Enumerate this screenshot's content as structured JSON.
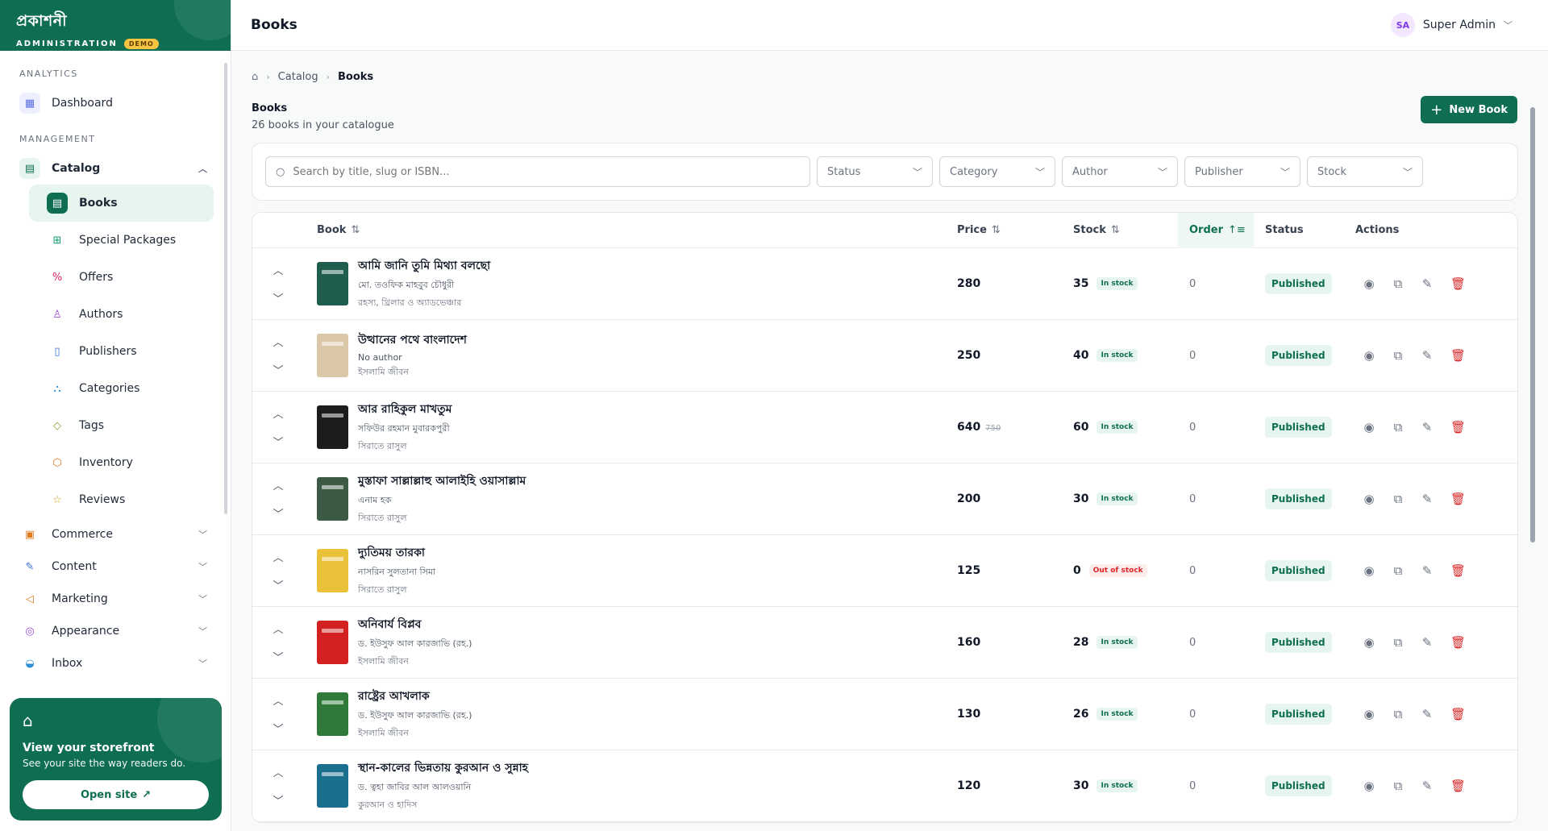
{
  "brand": {
    "name": "প্রকাশনী",
    "sub": "ADMINISTRATION",
    "badge": "DEMO"
  },
  "sidebar": {
    "analytics_label": "ANALYTICS",
    "dashboard": "Dashboard",
    "management_label": "MANAGEMENT",
    "catalog": "Catalog",
    "catalog_items": [
      "Books",
      "Special Packages",
      "Offers",
      "Authors",
      "Publishers",
      "Categories",
      "Tags",
      "Inventory",
      "Reviews"
    ],
    "groups": [
      "Commerce",
      "Content",
      "Marketing",
      "Appearance",
      "Inbox"
    ]
  },
  "storefront": {
    "title": "View your storefront",
    "sub": "See your site the way readers do.",
    "button": "Open site"
  },
  "header": {
    "title": "Books",
    "user_initials": "SA",
    "user_name": "Super Admin"
  },
  "breadcrumb": {
    "parent": "Catalog",
    "current": "Books"
  },
  "page": {
    "title": "Books",
    "subtitle": "26 books in your catalogue",
    "new_button": "New Book"
  },
  "filters": {
    "search_placeholder": "Search by title, slug or ISBN...",
    "status": "Status",
    "category": "Category",
    "author": "Author",
    "publisher": "Publisher",
    "stock": "Stock"
  },
  "columns": {
    "book": "Book",
    "price": "Price",
    "stock": "Stock",
    "order": "Order",
    "status": "Status",
    "actions": "Actions"
  },
  "colors": {
    "brand": "#0f6e52",
    "danger": "#dc2626"
  },
  "books": [
    {
      "title": "আমি জানি তুমি মিথ্যা বলছো",
      "author": "মো. তওফিক মাহবুব চৌধুরী",
      "category": "রহস্য, থ্রিলার ও অ্যাডভেঞ্চার",
      "price": "280",
      "old_price": "",
      "stock": "35",
      "stock_label": "In stock",
      "in_stock": true,
      "order": "0",
      "status": "Published",
      "cover": "#1f5e4e"
    },
    {
      "title": "উত্থানের পথে বাংলাদেশ",
      "author": "No author",
      "category": "ইসলামি জীবন",
      "price": "250",
      "old_price": "",
      "stock": "40",
      "stock_label": "In stock",
      "in_stock": true,
      "order": "0",
      "status": "Published",
      "cover": "#d9c7a8"
    },
    {
      "title": "আর রাহিকুল মাখতুম",
      "author": "সফিউর রহমান মুবারকপুরী",
      "category": "সিরাতে রাসুল",
      "price": "640",
      "old_price": "750",
      "stock": "60",
      "stock_label": "In stock",
      "in_stock": true,
      "order": "0",
      "status": "Published",
      "cover": "#1c1c1c"
    },
    {
      "title": "মুস্তাফা সাল্লাল্লাহু আলাইহি ওয়াসাল্লাম",
      "author": "এনাম হক",
      "category": "সিরাতে রাসুল",
      "price": "200",
      "old_price": "",
      "stock": "30",
      "stock_label": "In stock",
      "in_stock": true,
      "order": "0",
      "status": "Published",
      "cover": "#3d5a45"
    },
    {
      "title": "দ্যুতিময় তারকা",
      "author": "নাসরিন সুলতানা সিমা",
      "category": "সিরাতে রাসুল",
      "price": "125",
      "old_price": "",
      "stock": "0",
      "stock_label": "Out of stock",
      "in_stock": false,
      "order": "0",
      "status": "Published",
      "cover": "#e9c23a"
    },
    {
      "title": "অনিবার্য বিপ্লব",
      "author": "ড. ইউসুফ আল কারজাভি (রহ.)",
      "category": "ইসলামি জীবন",
      "price": "160",
      "old_price": "",
      "stock": "28",
      "stock_label": "In stock",
      "in_stock": true,
      "order": "0",
      "status": "Published",
      "cover": "#d32121"
    },
    {
      "title": "রাষ্ট্রের আখলাক",
      "author": "ড. ইউসুফ আল কারজাভি (রহ.)",
      "category": "ইসলামি জীবন",
      "price": "130",
      "old_price": "",
      "stock": "26",
      "stock_label": "In stock",
      "in_stock": true,
      "order": "0",
      "status": "Published",
      "cover": "#2f7a3a"
    },
    {
      "title": "স্থান-কালের ভিন্নতায় কুরআন ও সুন্নাহ",
      "author": "ড. ত্বহা জাবির আল আলওয়ানি",
      "category": "কুরআন ও হাদিস",
      "price": "120",
      "old_price": "",
      "stock": "30",
      "stock_label": "In stock",
      "in_stock": true,
      "order": "0",
      "status": "Published",
      "cover": "#1b6f8e"
    }
  ]
}
